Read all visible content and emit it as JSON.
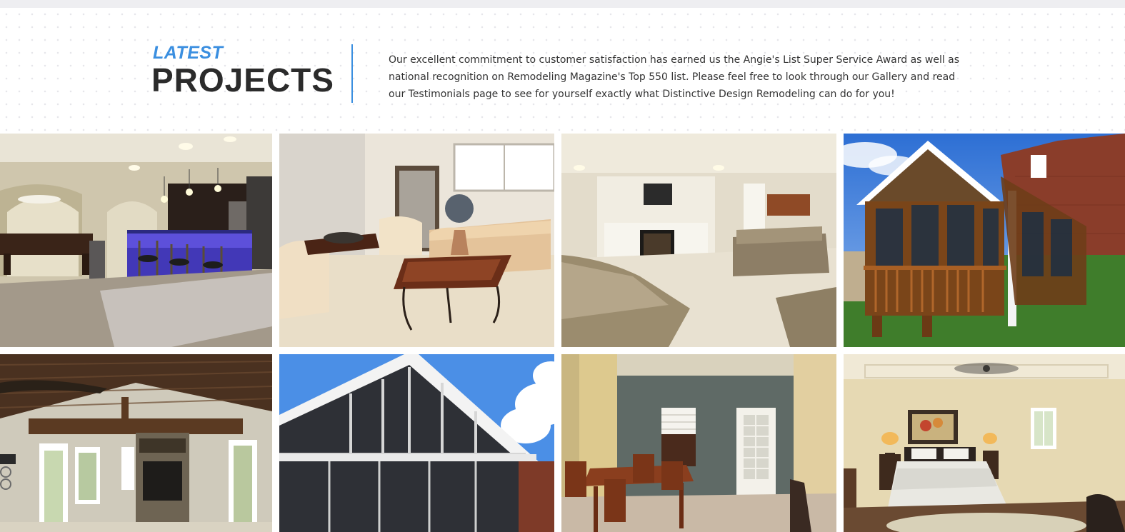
{
  "intro": {
    "kicker": "LATEST",
    "title": "PROJECTS",
    "description": "Our excellent commitment to customer satisfaction has earned us the Angie's List Super Service Award as well as national recognition on Remodeling Magazine's Top 550 list. Please feel free to look through our Gallery and read our Testimonials page to see for yourself exactly what Distinctive Design Remodeling can do for you!"
  },
  "colors": {
    "accent": "#3b8fe0",
    "heading": "#2b2b2b",
    "body_text": "#333333",
    "top_bar": "#eeeef1"
  },
  "gallery": {
    "items": [
      {
        "subject": "basement bar with pool table and blue under-counter lighting"
      },
      {
        "subject": "living room with beige sofas and wooden coffee table"
      },
      {
        "subject": "finished basement with fireplace, TV and sectional sofa"
      },
      {
        "subject": "screened porch addition on brick house"
      },
      {
        "subject": "vaulted wood ceiling family room with stone fireplace"
      },
      {
        "subject": "screened porch gable seen from below"
      },
      {
        "subject": "dining room with wooden table and french door"
      },
      {
        "subject": "bedroom with tray ceiling, ceiling fan and lamps"
      }
    ]
  }
}
